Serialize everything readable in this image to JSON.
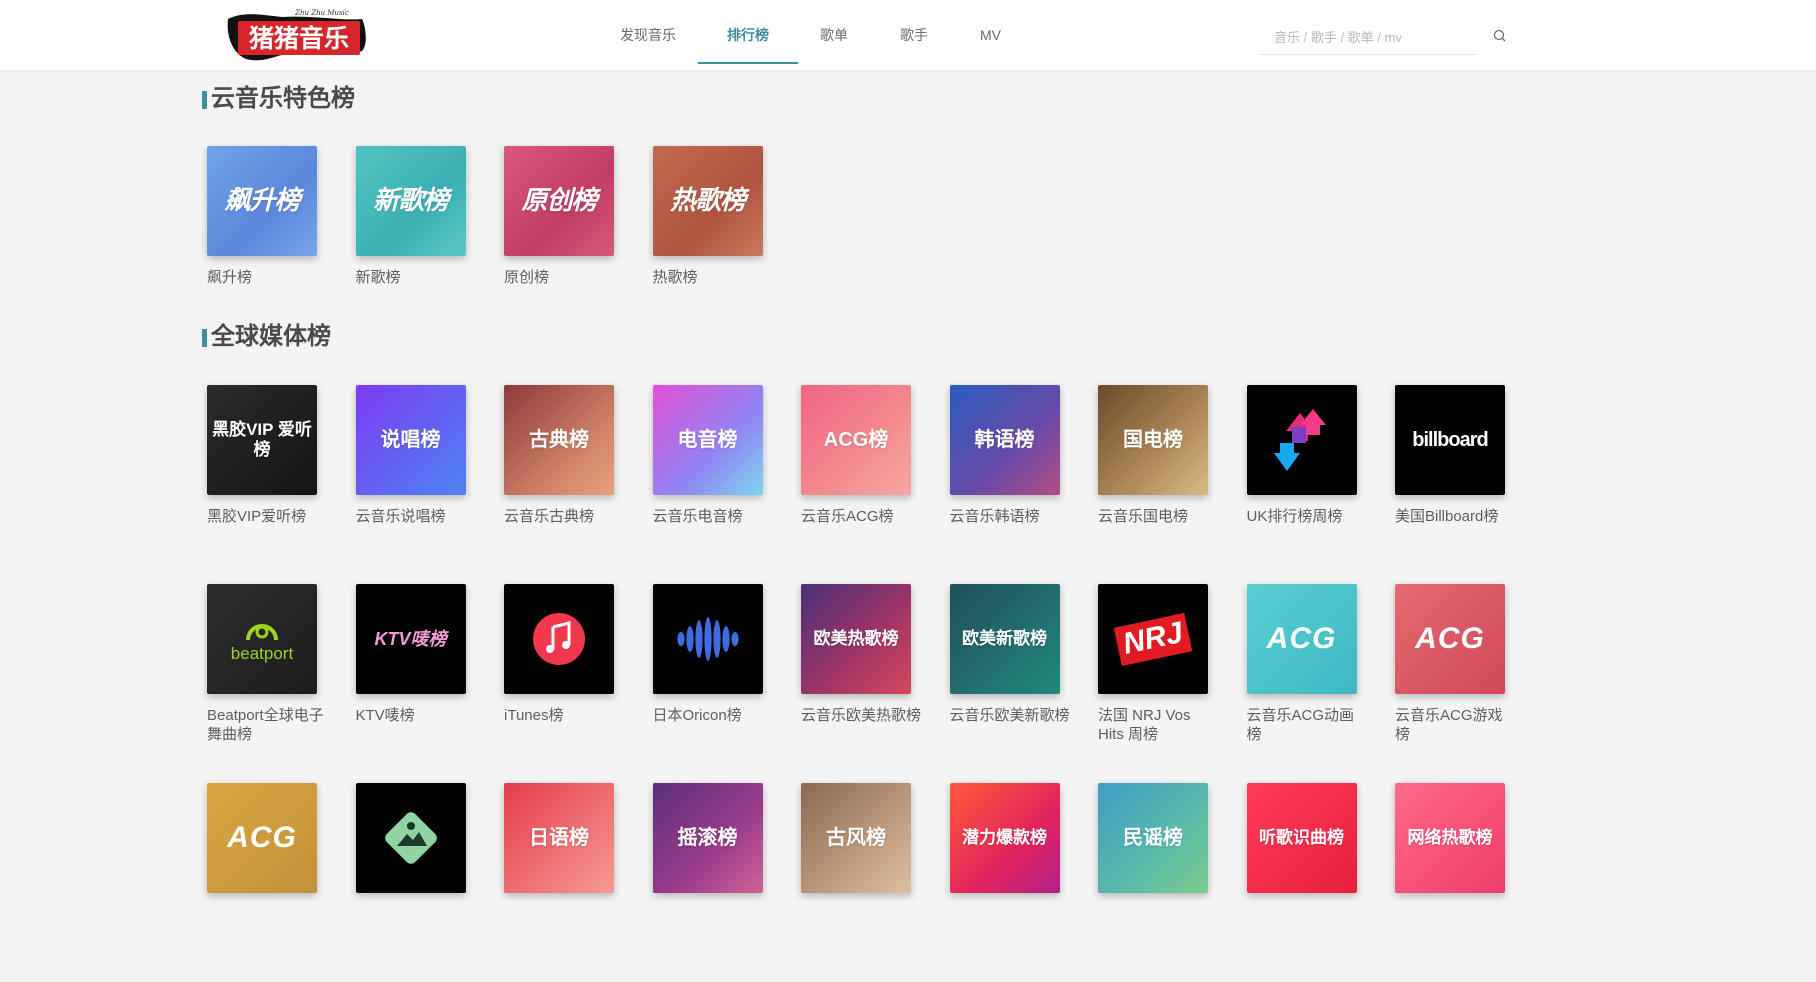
{
  "logo": {
    "text": "猪猪音乐",
    "subtitle": "Zhu Zhu Music"
  },
  "nav": {
    "items": [
      {
        "label": "发现音乐",
        "active": false
      },
      {
        "label": "排行榜",
        "active": true
      },
      {
        "label": "歌单",
        "active": false
      },
      {
        "label": "歌手",
        "active": false
      },
      {
        "label": "MV",
        "active": false
      }
    ]
  },
  "search": {
    "placeholder": "音乐 / 歌手 / 歌单 / mv",
    "value": "",
    "icon": "search-icon"
  },
  "colors": {
    "accent": "#3d8fa0"
  },
  "sections": [
    {
      "title": "云音乐特色榜",
      "rows": [
        [
          {
            "name": "飙升榜",
            "cover_text": "飙升榜",
            "big": true,
            "bg": "linear-gradient(135deg,#6fa4e6,#5c86dc 60%,#7aa6ea)"
          },
          {
            "name": "新歌榜",
            "cover_text": "新歌榜",
            "big": true,
            "bg": "linear-gradient(135deg,#52c4c2,#3bb0b4 60%,#5ac8c6)"
          },
          {
            "name": "原创榜",
            "cover_text": "原创榜",
            "big": true,
            "bg": "linear-gradient(135deg,#d9577d,#c13d63 60%,#d45a7a)"
          },
          {
            "name": "热歌榜",
            "cover_text": "热歌榜",
            "big": true,
            "bg": "linear-gradient(135deg,#c26a4f,#b05440 60%,#c97a5c)"
          }
        ]
      ]
    },
    {
      "title": "全球媒体榜",
      "rows": [
        [
          {
            "name": "黑胶VIP爱听榜",
            "cover_text": "黑胶VIP 爱听榜",
            "bg": "linear-gradient(135deg,#2b2b2b,#141414)"
          },
          {
            "name": "云音乐说唱榜",
            "cover_text": "说唱榜",
            "bg": "linear-gradient(135deg,#7b3cf2,#4e83f3)"
          },
          {
            "name": "云音乐古典榜",
            "cover_text": "古典榜",
            "bg": "linear-gradient(135deg,#8b3a3a,#d4876c 70%,#e6a27e)"
          },
          {
            "name": "云音乐电音榜",
            "cover_text": "电音榜",
            "bg": "linear-gradient(135deg,#e150d8,#8f86f3 60%,#7fd6f0)"
          },
          {
            "name": "云音乐ACG榜",
            "cover_text": "ACG榜",
            "bg": "linear-gradient(135deg,#f06485,#f48b8f 60%,#f6a8a4)"
          },
          {
            "name": "云音乐韩语榜",
            "cover_text": "韩语榜",
            "bg": "linear-gradient(135deg,#2b5bbf,#6a4aa6 60%,#b24d84)"
          },
          {
            "name": "云音乐国电榜",
            "cover_text": "国电榜",
            "bg": "linear-gradient(135deg,#6b4a2a,#b08a5a 60%,#d8bc84)"
          },
          {
            "name": "UK排行榜周榜",
            "cover_text": "",
            "bg": "#000000"
          },
          {
            "name": "美国Billboard榜",
            "cover_text": "billboard",
            "bg": "#000000"
          }
        ],
        [
          {
            "name": "Beatport全球电子舞曲榜",
            "cover_text": "beatport",
            "bg": "linear-gradient(135deg,#2d2d2d,#1d1d1d)"
          },
          {
            "name": "KTV唛榜",
            "cover_text": "KTV唛榜",
            "bg": "#000000"
          },
          {
            "name": "iTunes榜",
            "cover_text": "",
            "bg": "#000000"
          },
          {
            "name": "日本Oricon榜",
            "cover_text": "",
            "bg": "#000000"
          },
          {
            "name": "云音乐欧美热歌榜",
            "cover_text": "欧美热歌榜",
            "bg": "linear-gradient(135deg,#4a2f7a,#a33565 60%,#d44a5a)"
          },
          {
            "name": "云音乐欧美新歌榜",
            "cover_text": "欧美新歌榜",
            "bg": "linear-gradient(135deg,#1e4f5a,#23716f 60%,#1e8a7a)"
          },
          {
            "name": "法国 NRJ Vos Hits 周榜",
            "cover_text": "NRJ",
            "bg": "#000000"
          },
          {
            "name": "云音乐ACG动画榜",
            "cover_text": "ACG",
            "bg": "linear-gradient(135deg,#58cfd1,#3eb8c2)"
          },
          {
            "name": "云音乐ACG游戏榜",
            "cover_text": "ACG",
            "bg": "linear-gradient(135deg,#e46a70,#d1485a)"
          }
        ],
        [
          {
            "name": "",
            "cover_text": "ACG",
            "bg": "linear-gradient(135deg,#d9a641,#c2923a)"
          },
          {
            "name": "",
            "cover_text": "",
            "bg": "#000000"
          },
          {
            "name": "",
            "cover_text": "日语榜",
            "bg": "linear-gradient(135deg,#e53c4a,#f07e7e 70%,#f59b96)"
          },
          {
            "name": "",
            "cover_text": "摇滚榜",
            "bg": "linear-gradient(135deg,#5b2f7a,#9b3c8c 60%,#d06495)"
          },
          {
            "name": "",
            "cover_text": "古风榜",
            "bg": "linear-gradient(135deg,#8a6a52,#c9a487 70%,#dcc0a4)"
          },
          {
            "name": "",
            "cover_text": "潜力爆款榜",
            "bg": "linear-gradient(135deg,#ff5a3c,#e0245c 60%,#b1208a)"
          },
          {
            "name": "",
            "cover_text": "民谣榜",
            "bg": "linear-gradient(135deg,#3f9ec6,#5bbba8 60%,#7dcc8c)"
          },
          {
            "name": "",
            "cover_text": "听歌识曲榜",
            "bg": "linear-gradient(135deg,#ff3c5a,#e81e3c)"
          },
          {
            "name": "",
            "cover_text": "网络热歌榜",
            "bg": "linear-gradient(135deg,#ff6a8a,#f03c6a)"
          }
        ]
      ]
    }
  ]
}
